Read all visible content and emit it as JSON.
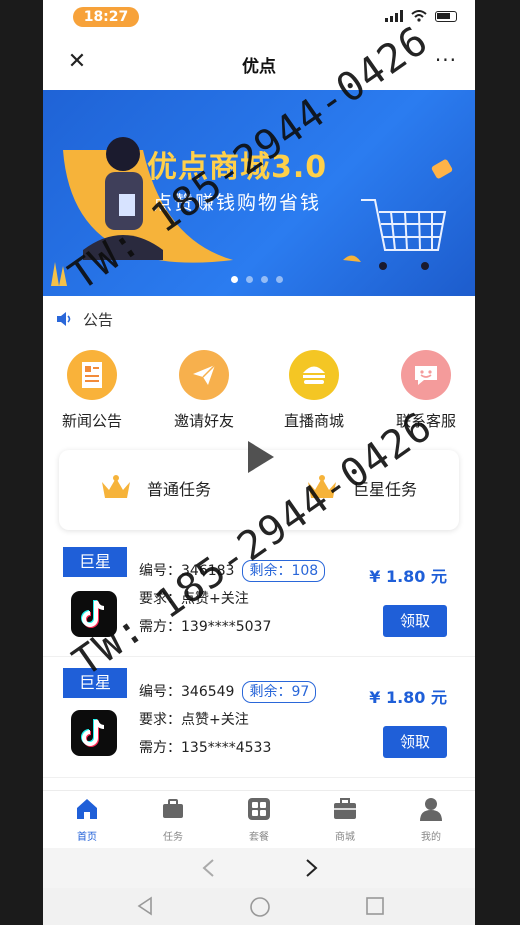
{
  "status_bar": {
    "time": "18:27"
  },
  "title_bar": {
    "title": "优点",
    "close_label": "✕",
    "more_label": "···"
  },
  "banner": {
    "title": "优点商城3.0",
    "subtitle": "点赞赚钱购物省钱",
    "active_dot": 0,
    "dot_count": 4
  },
  "notice": {
    "label": "公告"
  },
  "quick_menu": [
    {
      "label": "新闻公告",
      "icon": "news-icon",
      "color": "#f9b23a"
    },
    {
      "label": "邀请好友",
      "icon": "paper-plane-icon",
      "color": "#f7b04d"
    },
    {
      "label": "直播商城",
      "icon": "burger-icon",
      "color": "#f4c624"
    },
    {
      "label": "联系客服",
      "icon": "smile-icon",
      "color": "#f49b9b"
    }
  ],
  "task_types": [
    {
      "label": "普通任务",
      "icon": "crown-icon"
    },
    {
      "label": "巨星任务",
      "icon": "crown-icon"
    }
  ],
  "tasks": [
    {
      "tag": "巨星",
      "id_label": "编号：",
      "id": "346183",
      "remaining_label": "剩余：",
      "remaining": "108",
      "requirement_label": "要求：",
      "requirement": "点赞+关注",
      "phone_label": "需方：",
      "phone": "139****5037",
      "price": "¥ 1.80 元",
      "claim_label": "领取"
    },
    {
      "tag": "巨星",
      "id_label": "编号：",
      "id": "346549",
      "remaining_label": "剩余：",
      "remaining": "97",
      "requirement_label": "要求：",
      "requirement": "点赞+关注",
      "phone_label": "需方：",
      "phone": "135****4533",
      "price": "¥ 1.80 元",
      "claim_label": "领取"
    }
  ],
  "tab_bar": [
    {
      "label": "首页",
      "icon": "home-icon",
      "active": true
    },
    {
      "label": "任务",
      "icon": "briefcase-icon",
      "active": false
    },
    {
      "label": "套餐",
      "icon": "grid-icon",
      "active": false
    },
    {
      "label": "商城",
      "icon": "store-icon",
      "active": false
    },
    {
      "label": "我的",
      "icon": "user-icon",
      "active": false
    }
  ],
  "watermark": {
    "text": "TW: 185-2944-0426"
  },
  "colors": {
    "brand_blue": "#1f5fd8",
    "time_pill": "#f7a23a",
    "banner_yellow": "#ffd04a"
  }
}
